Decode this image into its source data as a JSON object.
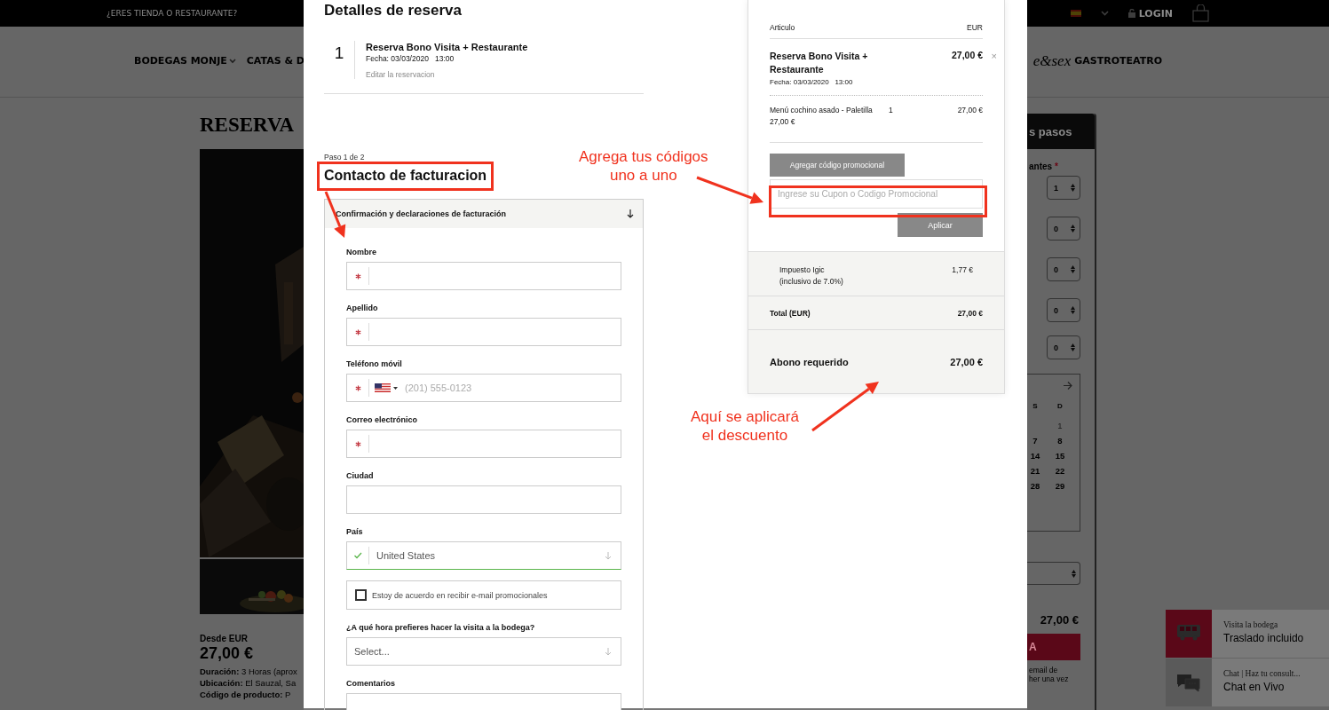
{
  "top_bar": {
    "notice": "¿ERES TIENDA O RESTAURANTE?",
    "login": "LOGIN"
  },
  "nav": {
    "items": [
      {
        "label": "BODEGAS MONJE",
        "has_menu": true
      },
      {
        "label": "CATAS & D",
        "has_menu": false
      }
    ],
    "brand": "e&sex",
    "last_item": "GASTROTEATRO"
  },
  "product": {
    "title": "RESERVA",
    "price_label": "Desde EUR",
    "price": "27,00 €",
    "details": [
      {
        "label": "Duración:",
        "value": "3 Horas (aprox"
      },
      {
        "label": "Ubicación:",
        "value": "El Sauzal, Sa"
      },
      {
        "label": "Código de producto:",
        "value": "P"
      }
    ]
  },
  "booking_sidebar": {
    "header": "s pasos",
    "label": "antes",
    "required": true,
    "required_mark": "*",
    "quantities": [
      "1",
      "0",
      "0",
      "0",
      "0"
    ],
    "calendar": {
      "days_header": [
        "S",
        "D"
      ],
      "days": [
        {
          "label": "1",
          "muted": true
        },
        {
          "label": "7",
          "muted": false
        },
        {
          "label": "8",
          "muted": false
        },
        {
          "label": "14",
          "muted": false
        },
        {
          "label": "15",
          "muted": false
        },
        {
          "label": "21",
          "muted": false
        },
        {
          "label": "22",
          "muted": false
        },
        {
          "label": "28",
          "muted": false
        },
        {
          "label": "29",
          "muted": false
        }
      ]
    },
    "price": "27,00 €",
    "button": "A",
    "note": [
      "email de",
      "her una vez"
    ]
  },
  "widgets": [
    {
      "kind": "bus",
      "title": "Visita la bodega",
      "text": "Traslado incluido"
    },
    {
      "kind": "chat",
      "title": "Chat | Haz tu consult...",
      "text": "Chat en Vivo"
    }
  ],
  "modal": {
    "title": "Detalles de reserva",
    "reservation": {
      "number": "1",
      "name": "Reserva Bono Visita + Restaurante",
      "date": "Fecha: 03/03/2020   13:00",
      "edit_link": "Editar la reservacion"
    },
    "step": "Paso 1 de 2",
    "section_title": "Contacto de facturacion",
    "accordion": {
      "title": "Confirmación y declaraciones de facturación",
      "expanded": true
    },
    "fields": [
      {
        "kind": "text",
        "label": "Nombre",
        "required": true
      },
      {
        "kind": "text",
        "label": "Apellido",
        "required": true
      },
      {
        "kind": "phone",
        "label": "Teléfono móvil",
        "required": true,
        "placeholder": "(201) 555-0123"
      },
      {
        "kind": "text",
        "label": "Correo electrónico",
        "required": true
      },
      {
        "kind": "text",
        "label": "Ciudad",
        "required": false
      },
      {
        "kind": "select",
        "label": "País",
        "valid": true,
        "value": "United States"
      },
      {
        "kind": "checkbox",
        "label": "Estoy de acuerdo en recibir e-mail promocionales",
        "checked": false
      },
      {
        "kind": "select",
        "label": "¿A qué hora prefieres hacer la visita a la bodega?",
        "valid": false,
        "value": "Select..."
      },
      {
        "kind": "textarea",
        "label": "Comentarios"
      }
    ]
  },
  "summary": {
    "columns": [
      "Articulo",
      "EUR"
    ],
    "item": {
      "name": "Reserva Bono Visita + Restaurante",
      "date": "Fecha: 03/03/2020   13:00",
      "price": "27,00 €",
      "remove": "×"
    },
    "lines": [
      {
        "name": "Menú cochino asado - Paletilla",
        "unit_price": "27,00 €",
        "qty": "1",
        "amount": "27,00 €"
      }
    ],
    "promo_button": "Agregar código promocional",
    "coupon_placeholder": "Ingrese su Cupon o Codigo Promocional",
    "apply_button": "Aplicar",
    "tax": {
      "label": "Impuesto Igic",
      "note": "(inclusivo de 7.0%)",
      "amount": "1,77 €"
    },
    "total": {
      "label": "Total (EUR)",
      "amount": "27,00 €"
    },
    "deposit": {
      "label": "Abono requerido",
      "amount": "27,00 €"
    }
  },
  "annotations": [
    {
      "text": "Agrega tus códigos\nuno a uno"
    },
    {
      "text": "Aquí se aplicará\nel descuento"
    }
  ]
}
